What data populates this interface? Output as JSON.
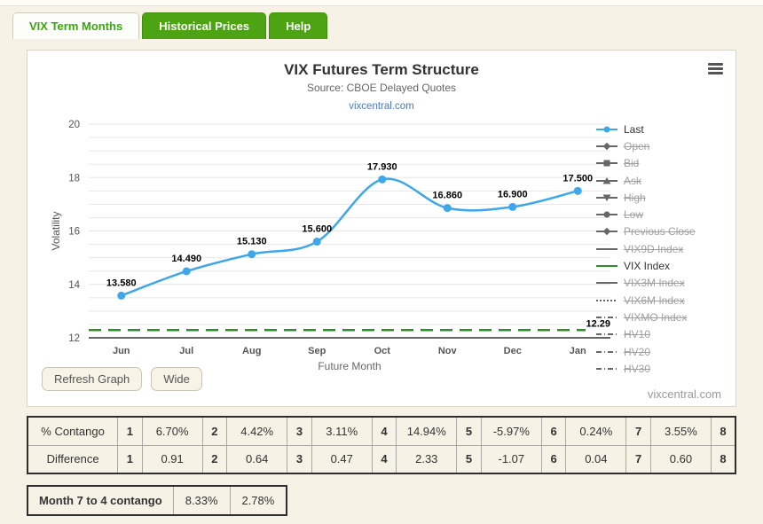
{
  "tabs": [
    {
      "label": "VIX Term Months",
      "active": true
    },
    {
      "label": "Historical Prices",
      "active": false
    },
    {
      "label": "Help",
      "active": false
    }
  ],
  "colors": {
    "accent_blue": "#3fa7e9",
    "accent_green": "#2d8c2d",
    "tab_green": "#4ca413",
    "disabled_marker": "#666666",
    "grid": "#e7e7e7",
    "axis": "#333333"
  },
  "chart_data": {
    "type": "line",
    "title": "VIX Futures Term Structure",
    "subtitle": "Source: CBOE Delayed Quotes",
    "link": "vixcentral.com",
    "watermark": "vixcentral.com",
    "xlabel": "Future Month",
    "ylabel": "Volatility",
    "ylim": [
      12,
      20
    ],
    "y_ticks": [
      12,
      14,
      16,
      18,
      20
    ],
    "minor_grid_step": 0.5,
    "grid": true,
    "legend_position": "right",
    "categories": [
      "Jun",
      "Jul",
      "Aug",
      "Sep",
      "Oct",
      "Nov",
      "Dec",
      "Jan"
    ],
    "series": [
      {
        "name": "Last",
        "type": "spline",
        "color": "#3fa7e9",
        "values": [
          13.58,
          14.49,
          15.13,
          15.6,
          17.93,
          16.86,
          16.9,
          17.5
        ],
        "point_labels": [
          "13.580",
          "14.490",
          "15.130",
          "15.600",
          "17.930",
          "16.860",
          "16.900",
          "17.500"
        ]
      },
      {
        "name": "VIX Index",
        "type": "hline",
        "color": "#2d8c2d",
        "value": 12.29,
        "label": "12.29",
        "dashed": true
      }
    ],
    "legend": [
      {
        "label": "Last",
        "symbol": "circle",
        "color": "#3fa7e9",
        "enabled": true
      },
      {
        "label": "Open",
        "symbol": "diamond",
        "enabled": false
      },
      {
        "label": "Bid",
        "symbol": "square",
        "enabled": false
      },
      {
        "label": "Ask",
        "symbol": "triangle",
        "enabled": false
      },
      {
        "label": "High",
        "symbol": "triangle-down",
        "enabled": false
      },
      {
        "label": "Low",
        "symbol": "circle",
        "enabled": false
      },
      {
        "label": "Previous Close",
        "symbol": "diamond",
        "enabled": false
      },
      {
        "label": "VIX9D Index",
        "symbol": "line",
        "enabled": false
      },
      {
        "label": "VIX Index",
        "symbol": "line",
        "color": "#2d8c2d",
        "enabled": true
      },
      {
        "label": "VIX3M Index",
        "symbol": "line",
        "enabled": false
      },
      {
        "label": "VIX6M Index",
        "symbol": "dotted",
        "enabled": false
      },
      {
        "label": "VIXMO Index",
        "symbol": "dashdot",
        "enabled": false
      },
      {
        "label": "HV10",
        "symbol": "dashdot",
        "enabled": false
      },
      {
        "label": "HV20",
        "symbol": "dashdot",
        "enabled": false
      },
      {
        "label": "HV30",
        "symbol": "dashdot",
        "enabled": false
      }
    ]
  },
  "buttons": {
    "refresh_label": "Refresh Graph",
    "wide_label": "Wide"
  },
  "contango_table": {
    "rows": [
      {
        "label": "% Contango",
        "cells": [
          "1",
          "6.70%",
          "2",
          "4.42%",
          "3",
          "3.11%",
          "4",
          "14.94%",
          "5",
          "-5.97%",
          "6",
          "0.24%",
          "7",
          "3.55%",
          "8"
        ]
      },
      {
        "label": "Difference",
        "cells": [
          "1",
          "0.91",
          "2",
          "0.64",
          "3",
          "0.47",
          "4",
          "2.33",
          "5",
          "-1.07",
          "6",
          "0.04",
          "7",
          "0.60",
          "8"
        ]
      }
    ]
  },
  "summary_table": {
    "label": "Month 7 to 4 contango",
    "values": [
      "8.33%",
      "2.78%"
    ]
  }
}
